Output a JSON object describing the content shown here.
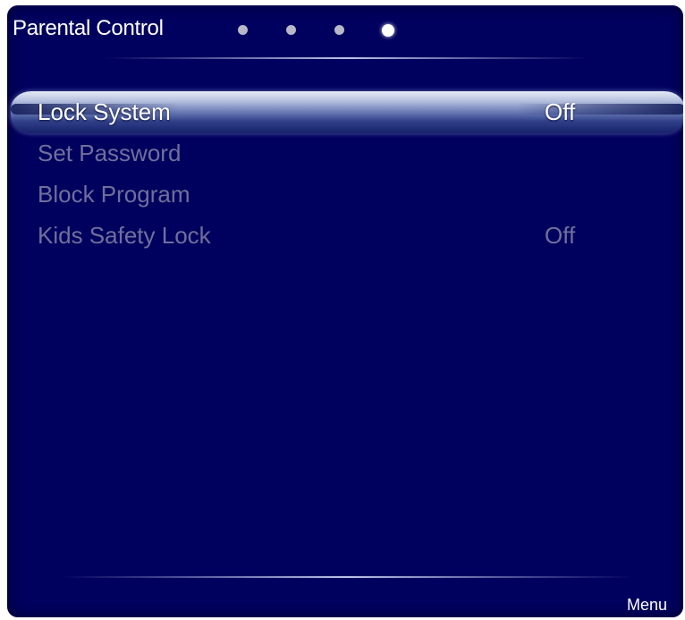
{
  "header": {
    "title": "Parental Control",
    "pages": [
      {
        "active": false
      },
      {
        "active": false
      },
      {
        "active": false
      },
      {
        "active": true
      }
    ]
  },
  "menu": {
    "items": [
      {
        "label": "Lock System",
        "value": "Off",
        "selected": true
      },
      {
        "label": "Set Password",
        "value": "",
        "selected": false
      },
      {
        "label": "Block Program",
        "value": "",
        "selected": false
      },
      {
        "label": "Kids Safety Lock",
        "value": "Off",
        "selected": false
      }
    ]
  },
  "footer": {
    "menu_label": "Menu"
  },
  "colors": {
    "panel_background": "#00005e",
    "selected_text": "#ffffff",
    "disabled_text": "#6f6f9c"
  }
}
